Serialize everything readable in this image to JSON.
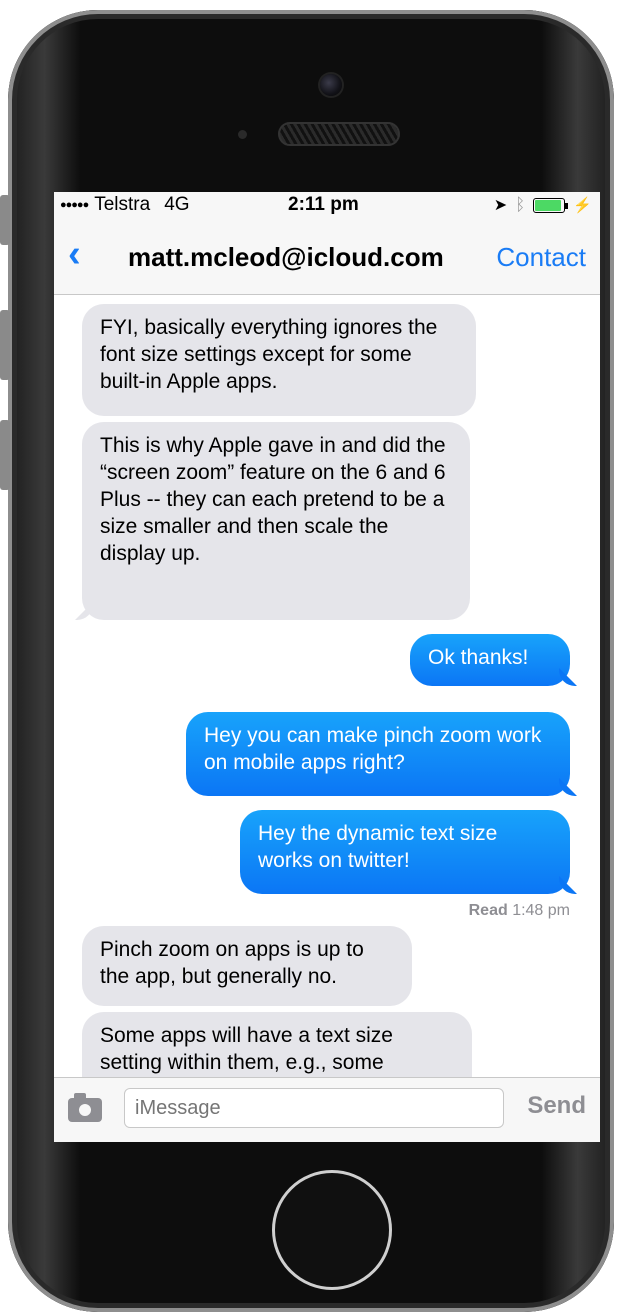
{
  "status": {
    "carrier": "Telstra",
    "network": "4G",
    "time": "2:11 pm",
    "signal_dots": "●●●●●",
    "location_icon": "location-arrow-icon",
    "bluetooth_icon": "bluetooth-icon",
    "battery_icon": "battery-icon",
    "battery_fraction": 1.0,
    "battery_color": "#4cd964"
  },
  "nav": {
    "back_glyph": "‹",
    "title": "matt.mcleod@icloud.com",
    "contact_label": "Contact"
  },
  "messages": [
    {
      "side": "in",
      "text": "FYI, basically everything ignores the font size settings except for some built-in Apple apps."
    },
    {
      "side": "in",
      "text": "This is why Apple gave in and did the “screen zoom” feature on the 6 and 6 Plus -- they can each pretend to be a size smaller and then scale the display up."
    },
    {
      "side": "out",
      "text": "Ok thanks!"
    },
    {
      "side": "out",
      "text": "Hey you can make pinch zoom work on mobile apps right?"
    },
    {
      "side": "out",
      "text": "Hey the dynamic text size works on twitter!"
    },
    {
      "side": "in",
      "text": "Pinch zoom on apps is up to the app, but generally no."
    },
    {
      "side": "in",
      "text": "Some apps will have a text size setting within them, e.g., some"
    }
  ],
  "receipt": {
    "label": "Read",
    "time": "1:48 pm"
  },
  "input": {
    "placeholder": "iMessage",
    "send_label": "Send"
  },
  "colors": {
    "accent": "#1a7cf5",
    "incoming_bubble": "#e5e5ea",
    "outgoing_bubble": "#0b76f5"
  }
}
